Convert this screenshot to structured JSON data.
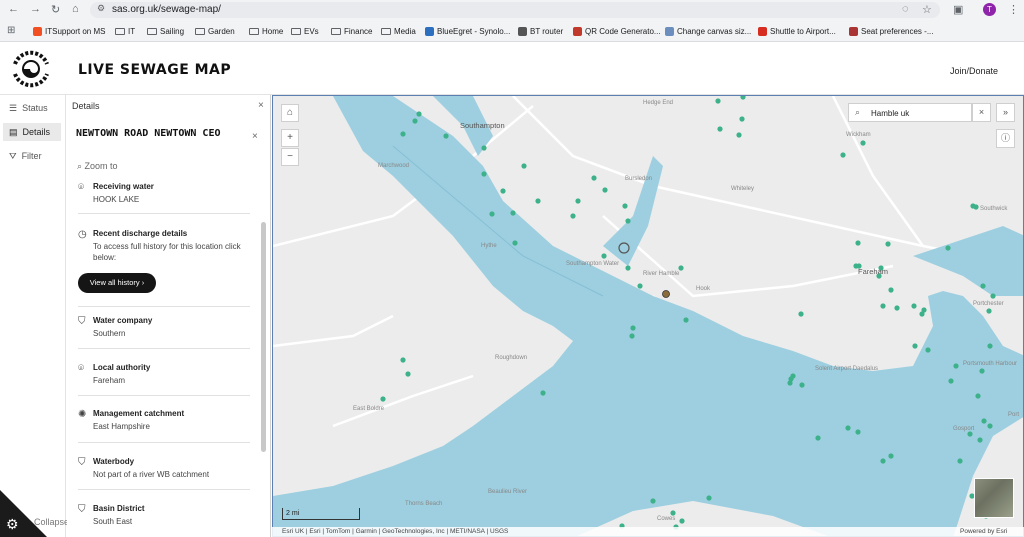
{
  "browser": {
    "url": "sas.org.uk/sewage-map/",
    "profile_initial": "T",
    "bookmarks": [
      {
        "label": "ITSupport on MS",
        "icon": "microsoft-icon"
      },
      {
        "label": "IT",
        "icon": "folder-icon"
      },
      {
        "label": "Sailing",
        "icon": "folder-icon"
      },
      {
        "label": "Garden",
        "icon": "folder-icon"
      },
      {
        "label": "Home",
        "icon": "folder-icon"
      },
      {
        "label": "EVs",
        "icon": "folder-icon"
      },
      {
        "label": "Finance",
        "icon": "folder-icon"
      },
      {
        "label": "Media",
        "icon": "folder-icon"
      },
      {
        "label": "BlueEgret - Synolo...",
        "icon": "synology-icon"
      },
      {
        "label": "BT router",
        "icon": "globe-icon"
      },
      {
        "label": "QR Code Generato...",
        "icon": "qr-icon"
      },
      {
        "label": "Change canvas siz...",
        "icon": "canvas-icon"
      },
      {
        "label": "Shuttle to Airport...",
        "icon": "p-icon"
      },
      {
        "label": "Seat preferences -...",
        "icon": "seat-icon"
      }
    ]
  },
  "app": {
    "logo_text": "SURFERS AGAINST SEWAGE",
    "title": "LIVE SEWAGE MAP",
    "join_label": "Join/Donate"
  },
  "rail": {
    "items": [
      {
        "label": "Status",
        "icon": "list-icon"
      },
      {
        "label": "Details",
        "icon": "details-icon"
      },
      {
        "label": "Filter",
        "icon": "filter-icon"
      }
    ],
    "collapse_label": "Collapse"
  },
  "panel": {
    "title": "Details",
    "place_name": "NEWTOWN ROAD NEWTOWN CEO",
    "zoom_to": "Zoom to",
    "sections": [
      {
        "label": "Receiving water",
        "value": "HOOK LAKE",
        "icon": "pin-icon"
      },
      {
        "label": "Recent discharge details",
        "value": "To access full history for this location click below:",
        "icon": "history-icon"
      },
      {
        "label": "Water company",
        "value": "Southern",
        "icon": "shield-icon"
      },
      {
        "label": "Local authority",
        "value": "Fareham",
        "icon": "pin-icon"
      },
      {
        "label": "Management catchment",
        "value": "East Hampshire",
        "icon": "catchment-icon"
      },
      {
        "label": "Waterbody",
        "value": "Not part of a river WB catchment",
        "icon": "waterbody-icon"
      },
      {
        "label": "Basin District",
        "value": "South East",
        "icon": "basin-icon"
      }
    ],
    "history_button": "View all history"
  },
  "map": {
    "search_value": "Hamble uk",
    "scale_label": "2 mi",
    "attribution": "Esri UK | Esri | TomTom | Garmin | GeoTechnologies, Inc | METI/NASA | USGS",
    "powered_by": "Powered by Esri",
    "labels": [
      {
        "text": "Southampton",
        "cls": "city"
      },
      {
        "text": "Hedge End",
        "cls": ""
      },
      {
        "text": "Wickham",
        "cls": ""
      },
      {
        "text": "Marchwood",
        "cls": ""
      },
      {
        "text": "Bursledon",
        "cls": ""
      },
      {
        "text": "Whiteley",
        "cls": ""
      },
      {
        "text": "Hythe",
        "cls": ""
      },
      {
        "text": "Southampton Water",
        "cls": ""
      },
      {
        "text": "Hook",
        "cls": ""
      },
      {
        "text": "River Hamble",
        "cls": ""
      },
      {
        "text": "Fareham",
        "cls": "city"
      },
      {
        "text": "Roughdown",
        "cls": ""
      },
      {
        "text": "East Boldre",
        "cls": ""
      },
      {
        "text": "Solent Airport Daedalus",
        "cls": ""
      },
      {
        "text": "Gosport",
        "cls": ""
      },
      {
        "text": "Portsmouth Harbour",
        "cls": ""
      },
      {
        "text": "Thorns Beach",
        "cls": ""
      },
      {
        "text": "Beaulieu River",
        "cls": ""
      },
      {
        "text": "Cowes",
        "cls": ""
      },
      {
        "text": "Portchester",
        "cls": ""
      },
      {
        "text": "Port",
        "cls": ""
      },
      {
        "text": "Southwick",
        "cls": ""
      }
    ]
  },
  "colors": {
    "water": "#9dcfe0",
    "land": "#ececec",
    "dot": "#3db28a",
    "selected": "#8a6d3b"
  }
}
